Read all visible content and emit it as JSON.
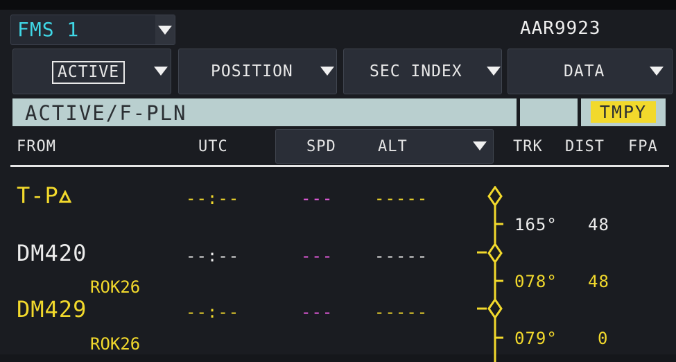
{
  "header": {
    "fms_label": "FMS 1",
    "callsign": "AAR9923"
  },
  "menus": [
    {
      "label": "ACTIVE"
    },
    {
      "label": "POSITION"
    },
    {
      "label": "SEC INDEX"
    },
    {
      "label": "DATA"
    }
  ],
  "title": {
    "page": "ACTIVE/F-PLN",
    "status": "TMPY"
  },
  "columns": {
    "from": "FROM",
    "utc": "UTC",
    "spd": "SPD",
    "alt": "ALT",
    "trk": "TRK",
    "dist": "DIST",
    "fpa": "FPA"
  },
  "rows": [
    {
      "ident": "T-P",
      "utc": "--:--",
      "spd": "---",
      "alt": "-----"
    },
    {
      "ident": "DM420",
      "utc": "--:--",
      "spd": "---",
      "alt": "-----",
      "airway": "ROK26"
    },
    {
      "ident": "DM429",
      "utc": "--:--",
      "spd": "---",
      "alt": "-----",
      "airway": "ROK26"
    }
  ],
  "legs": [
    {
      "trk": "165°",
      "dist": "48"
    },
    {
      "trk": "078°",
      "dist": "48"
    },
    {
      "trk": "079°",
      "dist": "0"
    }
  ],
  "colors": {
    "cyan": "#3fd7e6",
    "yellow": "#f2d92c",
    "magenta": "#e85ce0",
    "white": "#ececec"
  },
  "icons": {
    "overfly": "triangle-icon",
    "waypoint": "diamond-icon",
    "dropdown": "chevron-down-icon"
  }
}
